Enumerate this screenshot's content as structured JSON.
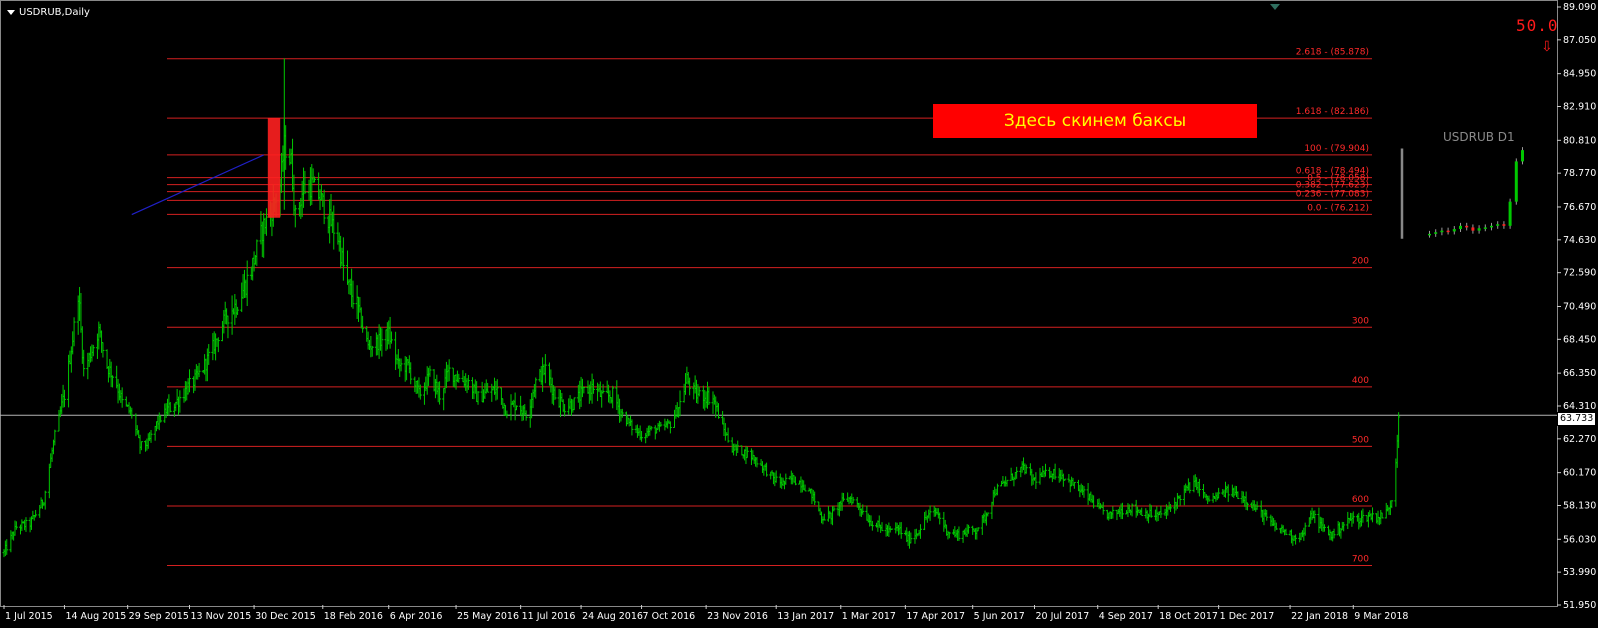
{
  "header": {
    "symbol_label": "USDRUB,Daily",
    "banner_text": "Здесь скинем баксы",
    "counter_text": "50.0",
    "down_icon": "down-arrow-icon",
    "mini_chart_title": "USDRUB D1",
    "current_price_label": "63.733"
  },
  "colors": {
    "background": "#000000",
    "candle": "#00c800",
    "level_line": "#d42020",
    "level_text": "#ff2a2a",
    "trend_line": "#2020c8",
    "highlight": "#ff2020",
    "banner": "#ff0000",
    "banner_text": "#ffff00",
    "price_line": "#b4b4b4"
  },
  "chart_data": {
    "type": "bar",
    "title": "USDRUB,Daily",
    "ylim": [
      51.95,
      89.09
    ],
    "y_ticks": [
      "89.090",
      "87.050",
      "84.950",
      "82.910",
      "80.810",
      "78.770",
      "76.670",
      "74.630",
      "72.590",
      "70.490",
      "68.450",
      "66.350",
      "64.310",
      "62.270",
      "60.170",
      "58.130",
      "56.030",
      "53.990",
      "51.950"
    ],
    "x_ticks": [
      "1 Jul 2015",
      "14 Aug 2015",
      "29 Sep 2015",
      "13 Nov 2015",
      "30 Dec 2015",
      "18 Feb 2016",
      "6 Apr 2016",
      "25 May 2016",
      "11 Jul 2016",
      "24 Aug 2016",
      "7 Oct 2016",
      "23 Nov 2016",
      "13 Jan 2017",
      "1 Mar 2017",
      "17 Apr 2017",
      "5 Jun 2017",
      "20 Jul 2017",
      "4 Sep 2017",
      "18 Oct 2017",
      "1 Dec 2017",
      "22 Jan 2018",
      "9 Mar 2018"
    ],
    "current_price": 63.733,
    "price_path": [
      {
        "date": "2015-07-01",
        "close": 55.2
      },
      {
        "date": "2015-07-10",
        "close": 56.8
      },
      {
        "date": "2015-07-20",
        "close": 57.0
      },
      {
        "date": "2015-07-30",
        "close": 58.5
      },
      {
        "date": "2015-08-07",
        "close": 62.5
      },
      {
        "date": "2015-08-14",
        "close": 65.0
      },
      {
        "date": "2015-08-20",
        "close": 68.5
      },
      {
        "date": "2015-08-24",
        "close": 71.5
      },
      {
        "date": "2015-08-28",
        "close": 66.5
      },
      {
        "date": "2015-09-03",
        "close": 67.8
      },
      {
        "date": "2015-09-08",
        "close": 69.0
      },
      {
        "date": "2015-09-14",
        "close": 66.8
      },
      {
        "date": "2015-09-20",
        "close": 66.0
      },
      {
        "date": "2015-09-25",
        "close": 64.5
      },
      {
        "date": "2015-10-02",
        "close": 63.8
      },
      {
        "date": "2015-10-08",
        "close": 61.8
      },
      {
        "date": "2015-10-14",
        "close": 62.0
      },
      {
        "date": "2015-10-20",
        "close": 63.2
      },
      {
        "date": "2015-10-27",
        "close": 64.0
      },
      {
        "date": "2015-11-04",
        "close": 64.6
      },
      {
        "date": "2015-11-11",
        "close": 65.4
      },
      {
        "date": "2015-11-18",
        "close": 66.0
      },
      {
        "date": "2015-11-25",
        "close": 67.0
      },
      {
        "date": "2015-12-03",
        "close": 68.5
      },
      {
        "date": "2015-12-10",
        "close": 70.0
      },
      {
        "date": "2015-12-16",
        "close": 70.5
      },
      {
        "date": "2015-12-22",
        "close": 71.5
      },
      {
        "date": "2015-12-28",
        "close": 72.8
      },
      {
        "date": "2016-01-06",
        "close": 75.5
      },
      {
        "date": "2016-01-12",
        "close": 76.5
      },
      {
        "date": "2016-01-18",
        "close": 78.0
      },
      {
        "date": "2016-01-21",
        "close": 80.5
      },
      {
        "date": "2016-01-26",
        "close": 79.5
      },
      {
        "date": "2016-01-29",
        "close": 76.0
      },
      {
        "date": "2016-02-04",
        "close": 77.8
      },
      {
        "date": "2016-02-10",
        "close": 78.0
      },
      {
        "date": "2016-02-16",
        "close": 77.3
      },
      {
        "date": "2016-02-22",
        "close": 76.0
      },
      {
        "date": "2016-02-29",
        "close": 74.8
      },
      {
        "date": "2016-03-06",
        "close": 72.0
      },
      {
        "date": "2016-03-14",
        "close": 70.5
      },
      {
        "date": "2016-03-22",
        "close": 68.0
      },
      {
        "date": "2016-03-30",
        "close": 68.3
      },
      {
        "date": "2016-04-06",
        "close": 68.8
      },
      {
        "date": "2016-04-13",
        "close": 66.8
      },
      {
        "date": "2016-04-20",
        "close": 66.8
      },
      {
        "date": "2016-04-28",
        "close": 65.0
      },
      {
        "date": "2016-05-06",
        "close": 66.2
      },
      {
        "date": "2016-05-13",
        "close": 65.0
      },
      {
        "date": "2016-05-20",
        "close": 66.5
      },
      {
        "date": "2016-05-27",
        "close": 66.0
      },
      {
        "date": "2016-06-03",
        "close": 65.8
      },
      {
        "date": "2016-06-10",
        "close": 64.8
      },
      {
        "date": "2016-06-17",
        "close": 65.2
      },
      {
        "date": "2016-06-24",
        "close": 65.3
      },
      {
        "date": "2016-07-01",
        "close": 64.0
      },
      {
        "date": "2016-07-08",
        "close": 64.5
      },
      {
        "date": "2016-07-15",
        "close": 63.8
      },
      {
        "date": "2016-07-22",
        "close": 65.8
      },
      {
        "date": "2016-07-29",
        "close": 66.6
      },
      {
        "date": "2016-08-05",
        "close": 65.0
      },
      {
        "date": "2016-08-12",
        "close": 64.3
      },
      {
        "date": "2016-08-19",
        "close": 64.5
      },
      {
        "date": "2016-08-26",
        "close": 65.2
      },
      {
        "date": "2016-09-02",
        "close": 65.5
      },
      {
        "date": "2016-09-09",
        "close": 64.8
      },
      {
        "date": "2016-09-16",
        "close": 65.0
      },
      {
        "date": "2016-09-23",
        "close": 63.8
      },
      {
        "date": "2016-09-30",
        "close": 63.0
      },
      {
        "date": "2016-10-07",
        "close": 62.5
      },
      {
        "date": "2016-10-14",
        "close": 62.8
      },
      {
        "date": "2016-10-21",
        "close": 62.9
      },
      {
        "date": "2016-10-28",
        "close": 63.2
      },
      {
        "date": "2016-11-04",
        "close": 64.5
      },
      {
        "date": "2016-11-09",
        "close": 66.0
      },
      {
        "date": "2016-11-15",
        "close": 65.0
      },
      {
        "date": "2016-11-21",
        "close": 65.0
      },
      {
        "date": "2016-11-28",
        "close": 64.8
      },
      {
        "date": "2016-12-05",
        "close": 63.0
      },
      {
        "date": "2016-12-12",
        "close": 61.7
      },
      {
        "date": "2016-12-19",
        "close": 61.5
      },
      {
        "date": "2016-12-26",
        "close": 61.2
      },
      {
        "date": "2017-01-04",
        "close": 60.5
      },
      {
        "date": "2017-01-11",
        "close": 59.8
      },
      {
        "date": "2017-01-18",
        "close": 59.5
      },
      {
        "date": "2017-01-25",
        "close": 59.8
      },
      {
        "date": "2017-02-01",
        "close": 59.5
      },
      {
        "date": "2017-02-08",
        "close": 58.8
      },
      {
        "date": "2017-02-15",
        "close": 57.4
      },
      {
        "date": "2017-02-22",
        "close": 57.5
      },
      {
        "date": "2017-03-01",
        "close": 58.3
      },
      {
        "date": "2017-03-08",
        "close": 58.6
      },
      {
        "date": "2017-03-15",
        "close": 58.0
      },
      {
        "date": "2017-03-22",
        "close": 57.2
      },
      {
        "date": "2017-03-29",
        "close": 56.8
      },
      {
        "date": "2017-04-05",
        "close": 56.5
      },
      {
        "date": "2017-04-12",
        "close": 56.7
      },
      {
        "date": "2017-04-19",
        "close": 56.0
      },
      {
        "date": "2017-04-26",
        "close": 56.5
      },
      {
        "date": "2017-05-03",
        "close": 57.5
      },
      {
        "date": "2017-05-10",
        "close": 57.7
      },
      {
        "date": "2017-05-17",
        "close": 56.6
      },
      {
        "date": "2017-05-24",
        "close": 56.3
      },
      {
        "date": "2017-05-31",
        "close": 56.5
      },
      {
        "date": "2017-06-07",
        "close": 56.6
      },
      {
        "date": "2017-06-14",
        "close": 57.4
      },
      {
        "date": "2017-06-21",
        "close": 59.0
      },
      {
        "date": "2017-06-28",
        "close": 59.5
      },
      {
        "date": "2017-07-05",
        "close": 60.0
      },
      {
        "date": "2017-07-12",
        "close": 60.5
      },
      {
        "date": "2017-07-19",
        "close": 59.7
      },
      {
        "date": "2017-07-26",
        "close": 60.0
      },
      {
        "date": "2017-08-02",
        "close": 60.2
      },
      {
        "date": "2017-08-09",
        "close": 60.0
      },
      {
        "date": "2017-08-16",
        "close": 59.5
      },
      {
        "date": "2017-08-23",
        "close": 59.0
      },
      {
        "date": "2017-08-30",
        "close": 58.5
      },
      {
        "date": "2017-09-06",
        "close": 57.8
      },
      {
        "date": "2017-09-13",
        "close": 57.5
      },
      {
        "date": "2017-09-20",
        "close": 57.8
      },
      {
        "date": "2017-09-27",
        "close": 58.0
      },
      {
        "date": "2017-10-04",
        "close": 57.8
      },
      {
        "date": "2017-10-11",
        "close": 57.6
      },
      {
        "date": "2017-10-18",
        "close": 57.5
      },
      {
        "date": "2017-10-25",
        "close": 57.8
      },
      {
        "date": "2017-11-01",
        "close": 58.5
      },
      {
        "date": "2017-11-08",
        "close": 59.2
      },
      {
        "date": "2017-11-15",
        "close": 59.5
      },
      {
        "date": "2017-11-22",
        "close": 58.5
      },
      {
        "date": "2017-11-29",
        "close": 58.6
      },
      {
        "date": "2017-12-06",
        "close": 59.0
      },
      {
        "date": "2017-12-13",
        "close": 58.9
      },
      {
        "date": "2017-12-20",
        "close": 58.6
      },
      {
        "date": "2017-12-27",
        "close": 58.0
      },
      {
        "date": "2018-01-03",
        "close": 57.5
      },
      {
        "date": "2018-01-10",
        "close": 56.8
      },
      {
        "date": "2018-01-17",
        "close": 56.6
      },
      {
        "date": "2018-01-24",
        "close": 56.2
      },
      {
        "date": "2018-01-31",
        "close": 56.3
      },
      {
        "date": "2018-02-07",
        "close": 57.6
      },
      {
        "date": "2018-02-14",
        "close": 56.8
      },
      {
        "date": "2018-02-21",
        "close": 56.3
      },
      {
        "date": "2018-02-28",
        "close": 56.8
      },
      {
        "date": "2018-03-07",
        "close": 57.3
      },
      {
        "date": "2018-03-14",
        "close": 57.3
      },
      {
        "date": "2018-03-21",
        "close": 57.5
      },
      {
        "date": "2018-03-28",
        "close": 57.4
      },
      {
        "date": "2018-04-03",
        "close": 57.8
      },
      {
        "date": "2018-04-06",
        "close": 58.5
      },
      {
        "date": "2018-04-09",
        "close": 61.0
      },
      {
        "date": "2018-04-11",
        "close": 63.7
      }
    ],
    "fib_levels": [
      {
        "label": "2.618 - (85.878)",
        "value": 85.878
      },
      {
        "label": "1.618 - (82.186)",
        "value": 82.186
      },
      {
        "label": "100 - (79.904)",
        "value": 79.904
      },
      {
        "label": "0.618 - (78.494)",
        "value": 78.494
      },
      {
        "label": "0.5 - (78.058)",
        "value": 78.058
      },
      {
        "label": "0.382 - (77.623)",
        "value": 77.623
      },
      {
        "label": "0.236 - (77.083)",
        "value": 77.083
      },
      {
        "label": "0.0 - (76.212)",
        "value": 76.212
      },
      {
        "label": "200",
        "value": 72.9
      },
      {
        "label": "300",
        "value": 69.2
      },
      {
        "label": "400",
        "value": 65.5
      },
      {
        "label": "500",
        "value": 61.8
      },
      {
        "label": "600",
        "value": 58.1
      },
      {
        "label": "700",
        "value": 54.4
      }
    ],
    "trend_line": {
      "from_date": "2015-10-02",
      "from_value": 76.2,
      "to_date": "2016-01-06",
      "to_value": 79.9
    },
    "highlight_range": {
      "from_date": "2016-01-09",
      "to_date": "2016-01-18",
      "low": 76.0,
      "high": 82.2
    },
    "mini_chart": {
      "title": "USDRUB D1",
      "closes": [
        75.0,
        75.1,
        75.2,
        75.15,
        75.3,
        75.5,
        75.4,
        75.2,
        75.35,
        75.4,
        75.5,
        75.6,
        75.5,
        77.0,
        79.5,
        80.2
      ]
    }
  }
}
